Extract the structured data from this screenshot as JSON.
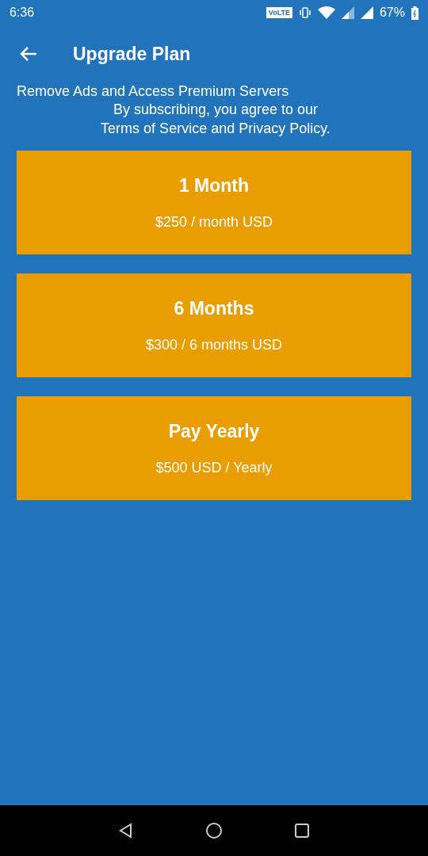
{
  "status_bar": {
    "time": "6:36",
    "network_badge": "VoLTE",
    "battery": "67%"
  },
  "app_bar": {
    "title": "Upgrade Plan"
  },
  "subtitle": "Remove Ads and Access Premium Servers",
  "notice_lines": [
    "By subscribing, you agree to our",
    "Terms of Service and Privacy Policy."
  ],
  "plans": [
    {
      "name": "1 Month",
      "price": "$250 / month USD"
    },
    {
      "name": "6 Months",
      "price": "$300 / 6 months USD"
    },
    {
      "name": "Pay Yearly",
      "price": "$500 USD / Yearly"
    }
  ]
}
